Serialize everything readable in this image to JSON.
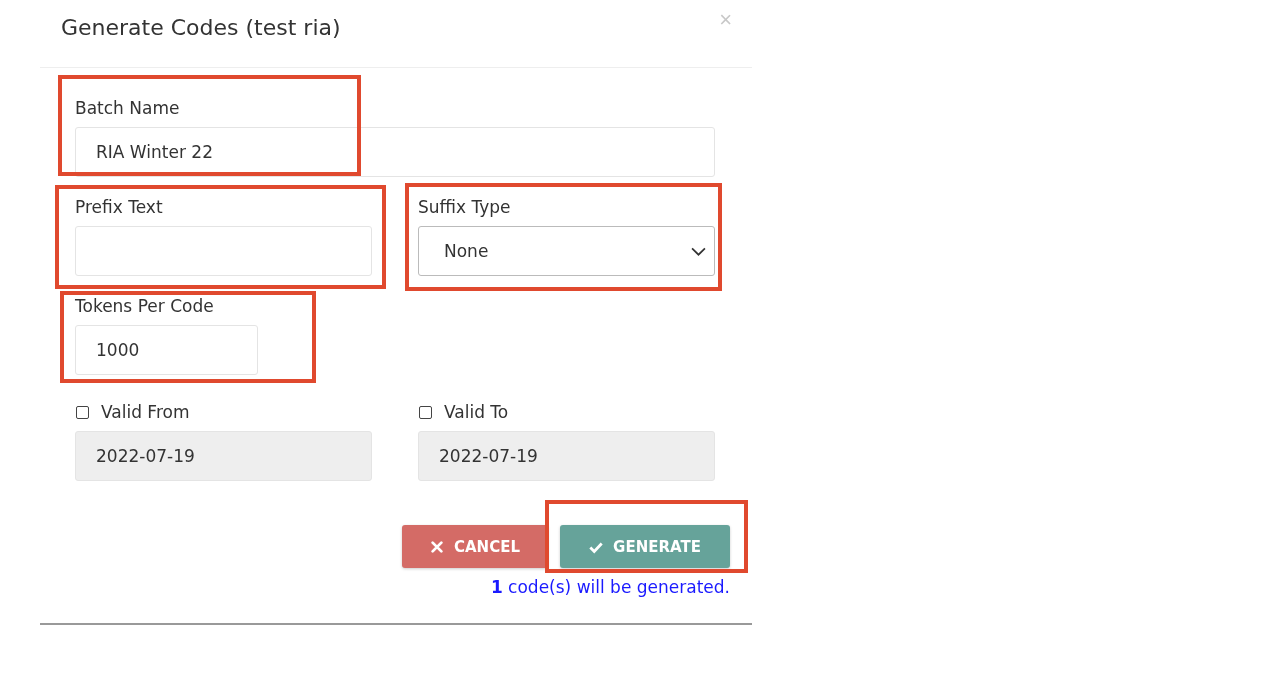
{
  "dialog": {
    "title": "Generate Codes (test ria)",
    "close": "×"
  },
  "fields": [
    {
      "kind": "wide_text",
      "label": "Batch Name",
      "value": "RIA Winter 22",
      "highlighted": true
    },
    {
      "kind": "text",
      "label": "Prefix Text",
      "highlighted": true
    },
    {
      "kind": "select",
      "label": "Suffix Type",
      "value": "None",
      "highlighted": true
    },
    {
      "kind": "number",
      "label": "Tokens Per Code",
      "value": "1000",
      "highlighted": true
    },
    {
      "kind": "date",
      "label": "Valid From",
      "value": "2022-07-19",
      "checked": false,
      "disabled": true,
      "highlighted": false
    },
    {
      "kind": "date",
      "label": "Valid To",
      "value": "2022-07-19",
      "checked": false,
      "disabled": true,
      "highlighted": false
    }
  ],
  "buttons": [
    {
      "kind": "cancel",
      "label": "CANCEL",
      "highlighted": false
    },
    {
      "kind": "generate",
      "label": "GENERATE",
      "highlighted": true
    }
  ],
  "note": "**1** code(s) will be generated."
}
